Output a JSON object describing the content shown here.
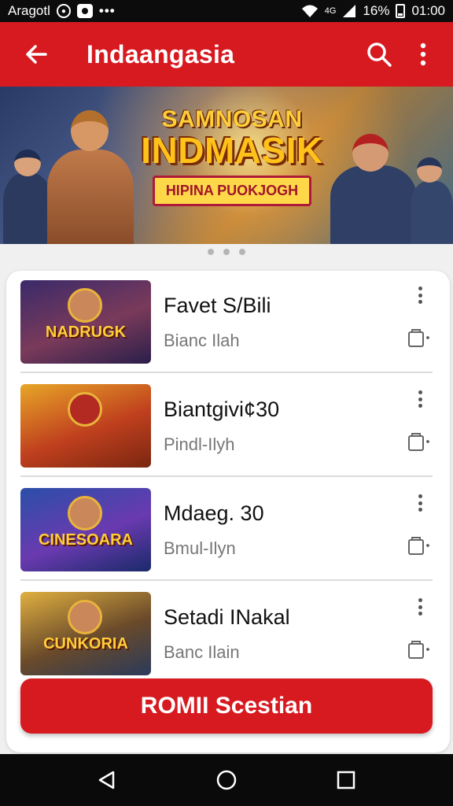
{
  "status_bar": {
    "left_text": "Aragotl",
    "dots": "•••",
    "network": "4G",
    "battery": "16%",
    "time": "01:00"
  },
  "app_bar": {
    "title": "Indaangasia",
    "back_icon": "arrow-left-icon",
    "search_icon": "search-icon",
    "more_icon": "more-vert-icon"
  },
  "banner": {
    "top": "SAMNOSAN",
    "main": "INDMASIK",
    "ribbon": "HIPINA PUOKJOGH"
  },
  "carousel": {
    "count": 3
  },
  "list": [
    {
      "title": "Favet S/Bili",
      "subtitle": "Bianc Ilah",
      "thumb_text": "NADRUGK"
    },
    {
      "title": "Biantgivi¢30",
      "subtitle": "Pindl-Ilyh",
      "thumb_text": ""
    },
    {
      "title": "Mdaeg. 30",
      "subtitle": "Bmul-Ilyn",
      "thumb_text": "CINESOARA"
    },
    {
      "title": "Setadi INakal",
      "subtitle": "Banc Ilain",
      "thumb_text": "CUNKORIA"
    }
  ],
  "cta": {
    "label": "ROMII Scestian"
  },
  "colors": {
    "accent": "#d71920"
  },
  "nav": {
    "back_icon": "triangle-back-icon",
    "home_icon": "circle-home-icon",
    "recent_icon": "square-recents-icon"
  }
}
